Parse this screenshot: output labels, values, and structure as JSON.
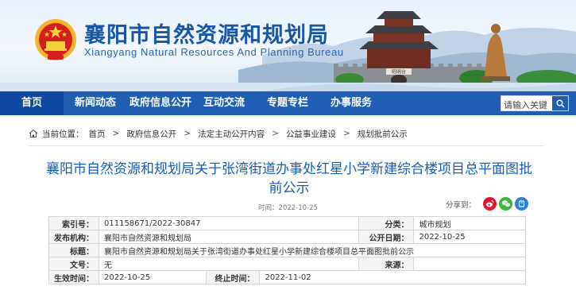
{
  "header": {
    "title": "襄阳市自然资源和规划局",
    "subtitle": "Xiangyang Natural Resources And Planning Bureau",
    "gate_plaque": "昭明台"
  },
  "nav": {
    "items": [
      {
        "label": "首页"
      },
      {
        "label": "新闻动态"
      },
      {
        "label": "政府信息公开"
      },
      {
        "label": "互动交流"
      },
      {
        "label": "专题专栏"
      },
      {
        "label": "办事服务"
      }
    ],
    "search_placeholder": "请输入关键"
  },
  "breadcrumb": {
    "label": "当前位置：",
    "items": [
      "首页",
      "政府信息公开",
      "法定主动公开内容",
      "公益事业建设",
      "规划批前公示"
    ],
    "separator": ">"
  },
  "article": {
    "title": "襄阳市自然资源和规划局关于张湾街道办事处红星小学新建综合楼项目总平面图批前公示",
    "time": "时间：2022-10-25",
    "share_label": "分享到："
  },
  "meta": {
    "index_key": "索引号：",
    "index_val": "011158671/2022-30847",
    "category_key": "分类：",
    "category_val": "城市规划",
    "publisher_key": "发布机构：",
    "publisher_val": "襄阳市自然资源和规划局",
    "date_key": "公开日期：",
    "date_val": "2022-10-25",
    "subject_key": "标题：",
    "subject_val": "襄阳市自然资源和规划局关于张湾街道办事处红星小学新建综合楼项目总平面图批前公示",
    "docno_key": "文号：",
    "docno_val": "无",
    "source_key": "来源：",
    "source_val": "",
    "effective_key": "生效时间：",
    "effective_val": "2022-10-25",
    "expire_key": "终止时间：",
    "expire_val": "2022-11-02"
  },
  "colors": {
    "nav_bg": "#1f5eb3",
    "nav_active": "#0d49a0",
    "title_blue": "#1a5bb5",
    "weibo": "#e6162d",
    "wechat": "#3db53a",
    "qzone": "#2e7ee6"
  },
  "icons": [
    "national-emblem-icon",
    "home-icon",
    "search-icon",
    "weibo-icon",
    "wechat-icon",
    "qzone-icon"
  ]
}
